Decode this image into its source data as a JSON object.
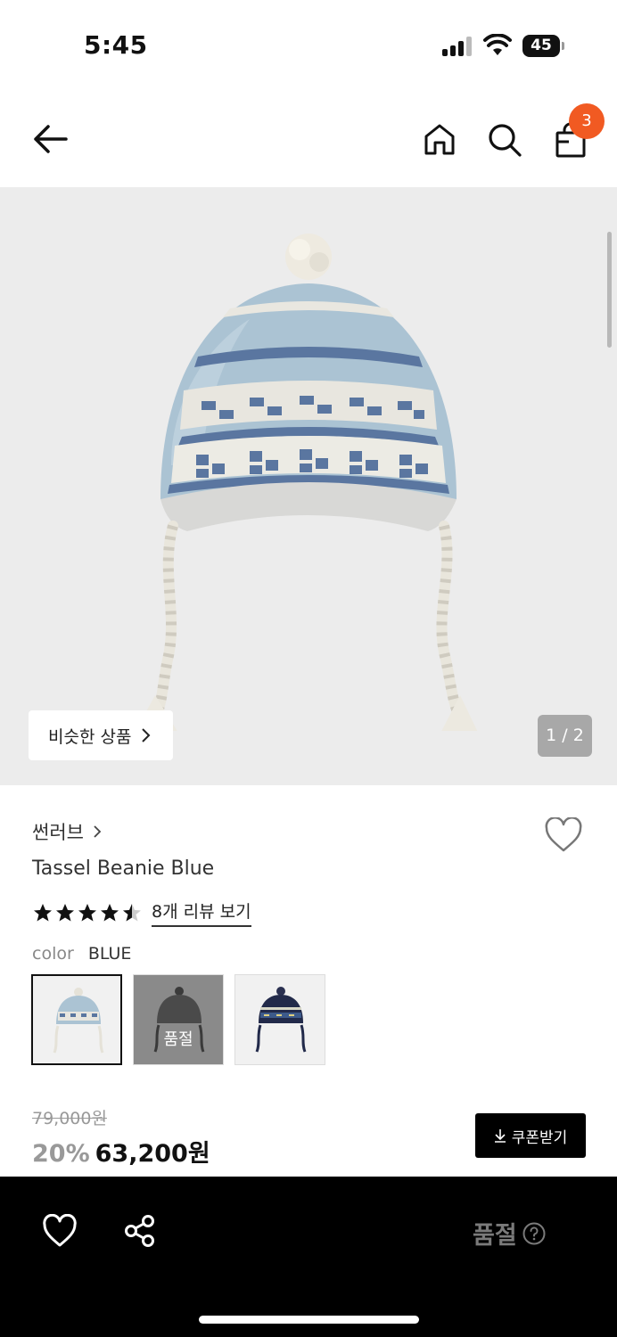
{
  "status_bar": {
    "time": "5:45",
    "battery": "45"
  },
  "nav": {
    "cart_count": "3"
  },
  "hero": {
    "similar_label": "비슷한 상품",
    "page_indicator": "1 / 2"
  },
  "product": {
    "brand": "썬러브",
    "name": "Tassel Beanie Blue",
    "rating": 4.5,
    "review_link": "8개 리뷰 보기",
    "color_label": "color",
    "color_value": "BLUE",
    "swatches": [
      {
        "color": "light blue",
        "selected": true,
        "sold_out": false
      },
      {
        "color": "charcoal",
        "selected": false,
        "sold_out": true,
        "label": "품절"
      },
      {
        "color": "navy",
        "selected": false,
        "sold_out": false
      }
    ],
    "original_price": "79,000원",
    "discount": "20%",
    "price": "63,200원",
    "coupon_label": "쿠폰받기"
  },
  "bottom_bar": {
    "status": "품절"
  },
  "colors": {
    "accent": "#f15a22",
    "hat_blue": "#a9c3d6",
    "hat_navy": "#5a76a0"
  }
}
